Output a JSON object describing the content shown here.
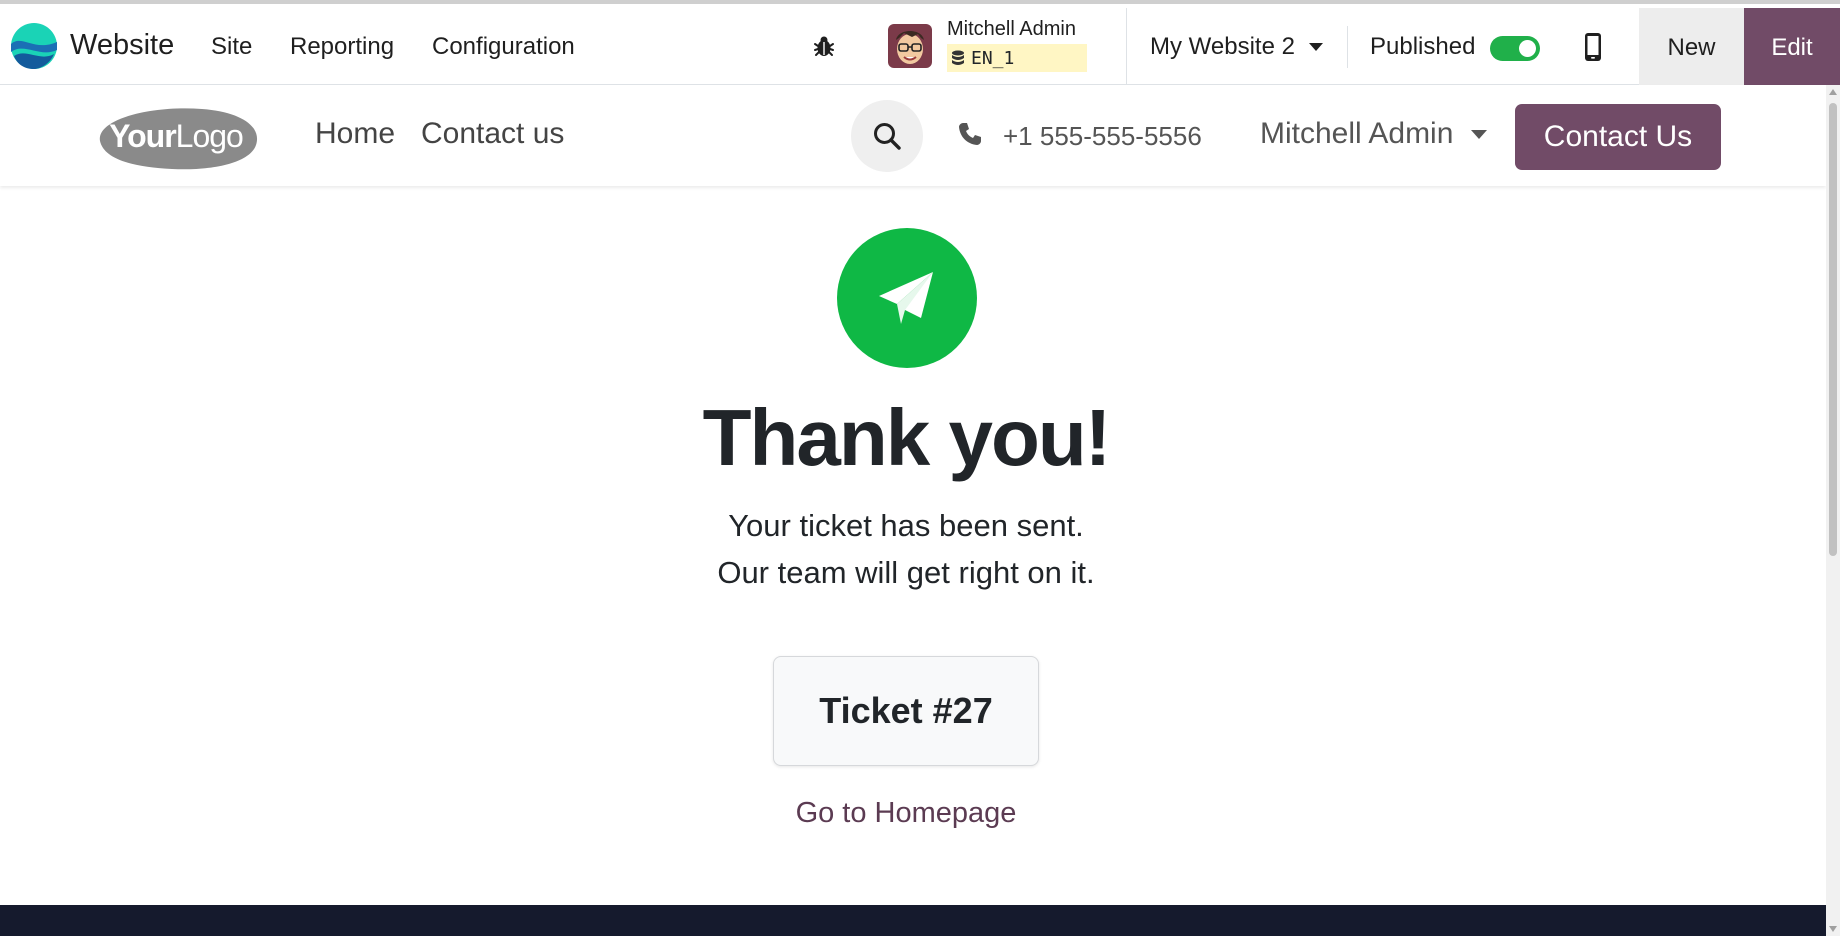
{
  "admin_bar": {
    "app_name": "Website",
    "menu": [
      "Site",
      "Reporting",
      "Configuration"
    ],
    "user_name": "Mitchell Admin",
    "database": "EN_1",
    "website_switcher": "My Website 2",
    "published_label": "Published",
    "published": true,
    "new_label": "New",
    "edit_label": "Edit"
  },
  "site_header": {
    "logo_text": "YourLogo",
    "nav": [
      "Home",
      "Contact us"
    ],
    "phone": "+1 555-555-5556",
    "user_menu": "Mitchell Admin",
    "cta_label": "Contact Us"
  },
  "main": {
    "title": "Thank you!",
    "line1": "Your ticket has been sent.",
    "line2": "Our team will get right on it.",
    "ticket": "Ticket #27",
    "homepage_link": "Go to Homepage"
  },
  "colors": {
    "brand": "#714b67",
    "success": "#0fb845",
    "toggle_on": "#20b04a",
    "footer": "#151a2d"
  }
}
